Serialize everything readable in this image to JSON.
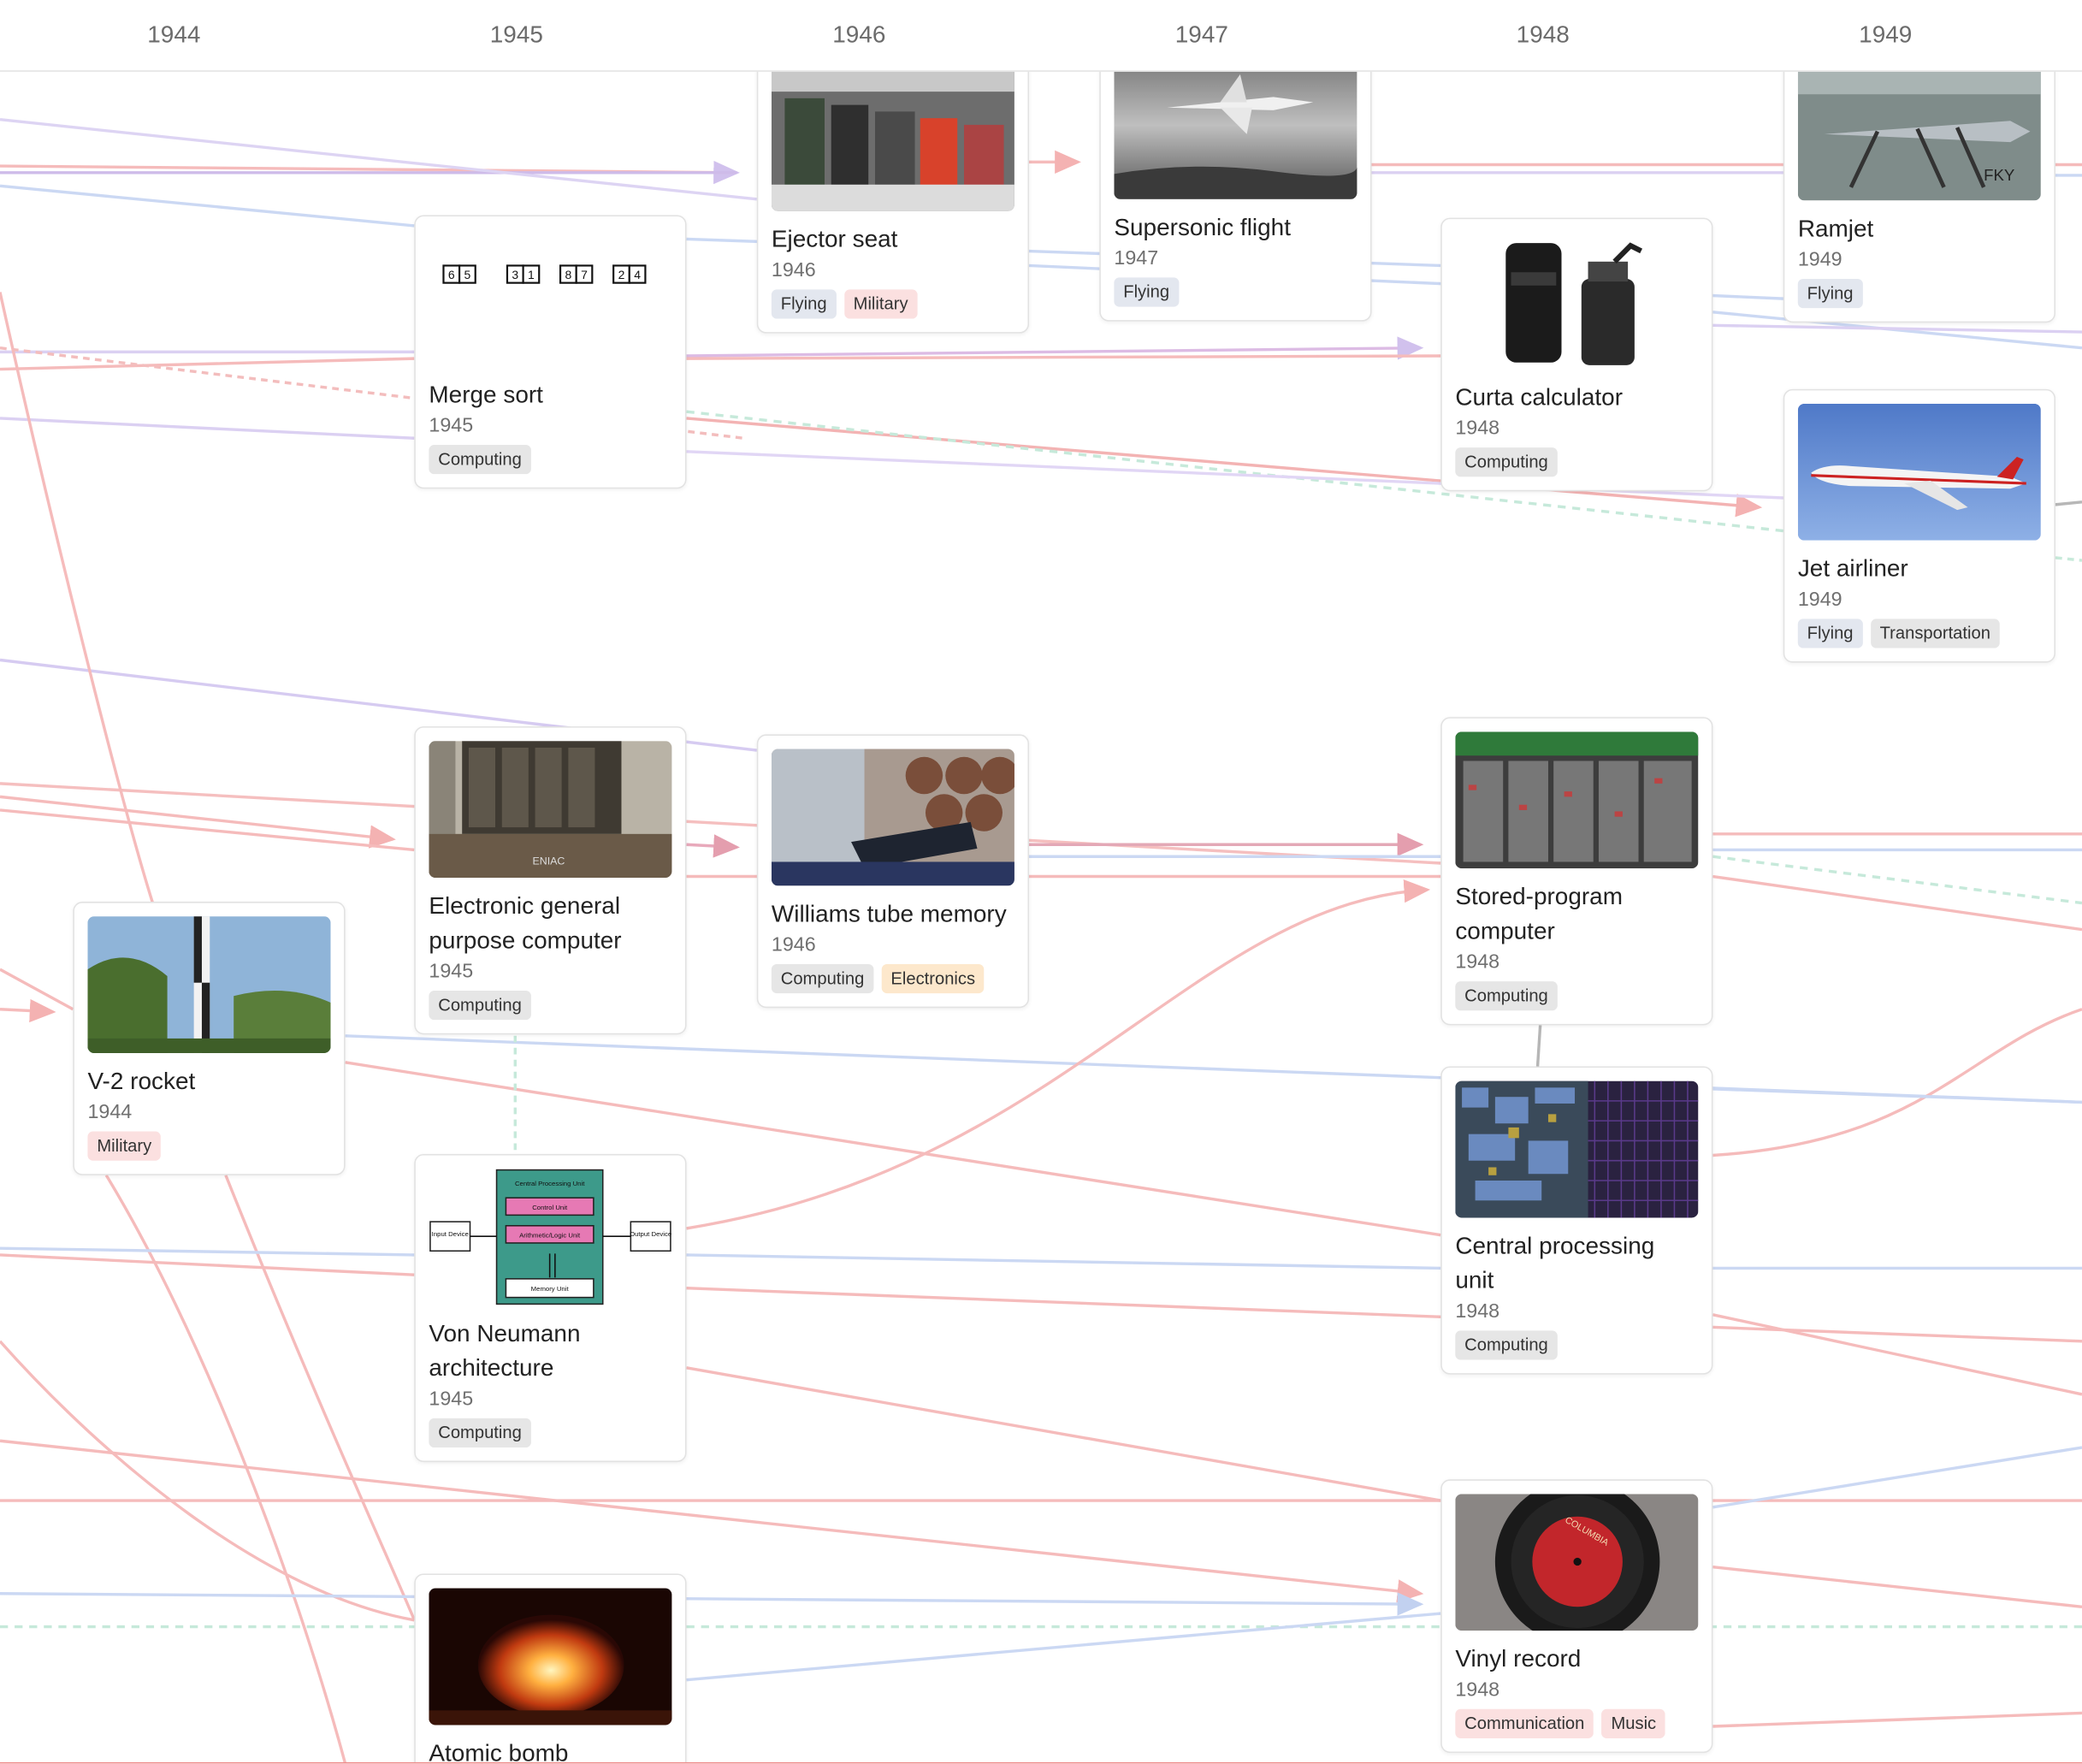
{
  "timeline": {
    "years": [
      "1944",
      "1945",
      "1946",
      "1947",
      "1948",
      "1949"
    ]
  },
  "cards": {
    "ejector_seat": {
      "title": "Ejector seat",
      "year": "1946",
      "tags": [
        "Flying",
        "Military"
      ],
      "image": "pilots-in-ejector-seats-photo"
    },
    "supersonic_flight": {
      "title": "Supersonic flight",
      "year": "1947",
      "tags": [
        "Flying"
      ],
      "image": "supersonic-jet-photo"
    },
    "ramjet": {
      "title": "Ramjet",
      "year": "1949",
      "tags": [
        "Flying"
      ],
      "image": "ramjet-aircraft-photo"
    },
    "merge_sort": {
      "title": "Merge sort",
      "year": "1945",
      "tags": [
        "Computing"
      ],
      "image": "merge-sort-diagram",
      "diagram_digits": [
        "6",
        "5",
        "3",
        "1",
        "8",
        "7",
        "2",
        "4"
      ]
    },
    "curta": {
      "title": "Curta calculator",
      "year": "1948",
      "tags": [
        "Computing"
      ],
      "image": "curta-calculator-photo"
    },
    "jet_airliner": {
      "title": "Jet airliner",
      "year": "1949",
      "tags": [
        "Flying",
        "Transportation"
      ],
      "image": "jet-airliner-photo"
    },
    "eniac": {
      "title": "Electronic general purpose computer",
      "year": "1945",
      "tags": [
        "Computing"
      ],
      "image": "eniac-photo",
      "photo_text": "ENIAC"
    },
    "williams_tube": {
      "title": "Williams tube memory",
      "year": "1946",
      "tags": [
        "Computing",
        "Electronics"
      ],
      "image": "williams-tube-photo"
    },
    "stored_program": {
      "title": "Stored-program computer",
      "year": "1948",
      "tags": [
        "Computing"
      ],
      "image": "stored-program-computer-photo"
    },
    "v2_rocket": {
      "title": "V-2 rocket",
      "year": "1944",
      "tags": [
        "Military"
      ],
      "image": "v2-rocket-photo"
    },
    "von_neumann": {
      "title": "Von Neumann architecture",
      "year": "1945",
      "tags": [
        "Computing"
      ],
      "image": "von-neumann-diagram",
      "diagram": {
        "cpu": "Central Processing Unit",
        "control": "Control Unit",
        "alu": "Arithmetic/Logic Unit",
        "memory": "Memory Unit",
        "input": "Input Device",
        "output": "Output Device"
      }
    },
    "cpu": {
      "title": "Central processing unit",
      "year": "1948",
      "tags": [
        "Computing"
      ],
      "image": "cpu-die-photo"
    },
    "atomic_bomb": {
      "title": "Atomic bomb",
      "year": "",
      "tags": [],
      "image": "atomic-explosion-photo"
    },
    "vinyl": {
      "title": "Vinyl record",
      "year": "1948",
      "tags": [
        "Communication",
        "Music"
      ],
      "image": "vinyl-record-photo",
      "label_text": "COLUMBIA"
    }
  },
  "colors": {
    "red_link": "#f2a0a0",
    "blue_link": "#b6c8ee",
    "purple_link": "#cdb8ee",
    "green_link": "#a8e0c8"
  }
}
